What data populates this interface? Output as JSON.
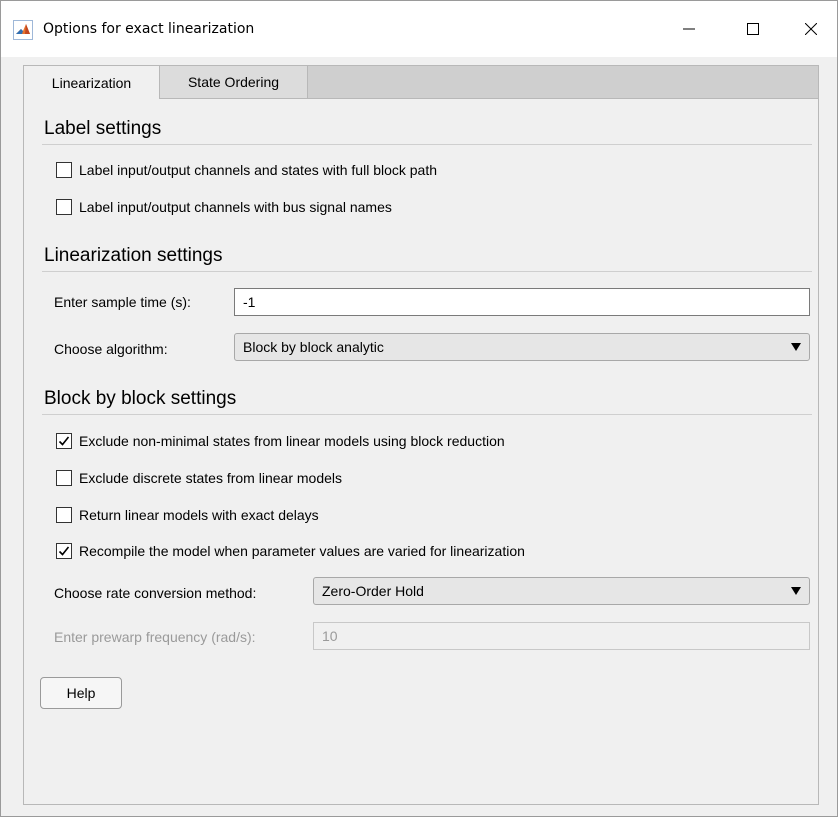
{
  "window": {
    "title": "Options for exact linearization",
    "icon": "matlab-logo-icon"
  },
  "tabs": [
    {
      "label": "Linearization",
      "active": true
    },
    {
      "label": "State Ordering",
      "active": false
    }
  ],
  "label_settings": {
    "title": "Label settings",
    "options": [
      {
        "label": "Label input/output channels and states with full block path",
        "checked": false
      },
      {
        "label": "Label input/output channels with bus signal names",
        "checked": false
      }
    ]
  },
  "linearization_settings": {
    "title": "Linearization settings",
    "sample_time_label": "Enter sample time (s):",
    "sample_time_value": "-1",
    "algorithm_label": "Choose algorithm:",
    "algorithm_value": "Block by block analytic"
  },
  "block_settings": {
    "title": "Block by block settings",
    "options": [
      {
        "label": "Exclude non-minimal states from linear models using block reduction",
        "checked": true
      },
      {
        "label": "Exclude discrete states from linear models",
        "checked": false
      },
      {
        "label": "Return linear models with exact delays",
        "checked": false
      },
      {
        "label": "Recompile the model when parameter values are varied for linearization",
        "checked": true
      }
    ],
    "rate_label": "Choose rate conversion method:",
    "rate_value": "Zero-Order Hold",
    "prewarp_label": "Enter prewarp frequency (rad/s):",
    "prewarp_value": "10"
  },
  "help_label": "Help"
}
